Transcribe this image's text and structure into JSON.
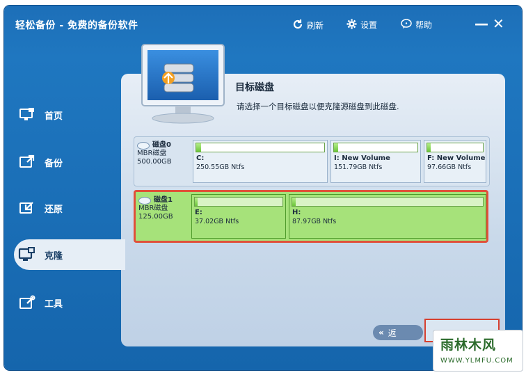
{
  "app": {
    "title": "轻松备份 - 免费的备份软件"
  },
  "toolbar": {
    "refresh": {
      "icon": "refresh-icon",
      "label": "刷新"
    },
    "settings": {
      "icon": "gear-icon",
      "label": "设置"
    },
    "help": {
      "icon": "help-bubble-icon",
      "label": "帮助"
    },
    "minimize": "—",
    "close": "✕"
  },
  "sidebar": {
    "items": [
      {
        "label": "首页",
        "icon": "home-monitor-icon"
      },
      {
        "label": "备份",
        "icon": "backup-icon"
      },
      {
        "label": "还原",
        "icon": "restore-icon"
      },
      {
        "label": "克隆",
        "icon": "clone-icon",
        "active": true
      },
      {
        "label": "工具",
        "icon": "tools-icon"
      }
    ]
  },
  "main": {
    "title": "目标磁盘",
    "description": "请选择一个目标磁盘以便克隆源磁盘到此磁盘."
  },
  "disks": [
    {
      "name": "磁盘0",
      "type": "MBR磁盘",
      "size": "500.00GB",
      "partitions": [
        {
          "label": "C:",
          "size": "250.55GB Ntfs",
          "used": 0.04
        },
        {
          "label": "I: New Volume",
          "size": "151.79GB Ntfs",
          "used": 0.05
        },
        {
          "label": "F: New Volume",
          "size": "97.66GB Ntfs",
          "used": 0.06
        }
      ]
    },
    {
      "name": "磁盘1",
      "type": "MBR磁盘",
      "size": "125.00GB",
      "partitions": [
        {
          "label": "E:",
          "size": "37.02GB Ntfs",
          "used": 0.03
        },
        {
          "label": "H:",
          "size": "87.97GB Ntfs",
          "used": 0.02
        }
      ]
    }
  ],
  "footer": {
    "back_label": "返"
  },
  "watermark": {
    "text": "雨林木风",
    "url": "WWW.YLMFU.COM"
  },
  "colors": {
    "window": "#1d6fb8",
    "selected_border": "#e0503a",
    "partition_green": "#a6e27a"
  }
}
